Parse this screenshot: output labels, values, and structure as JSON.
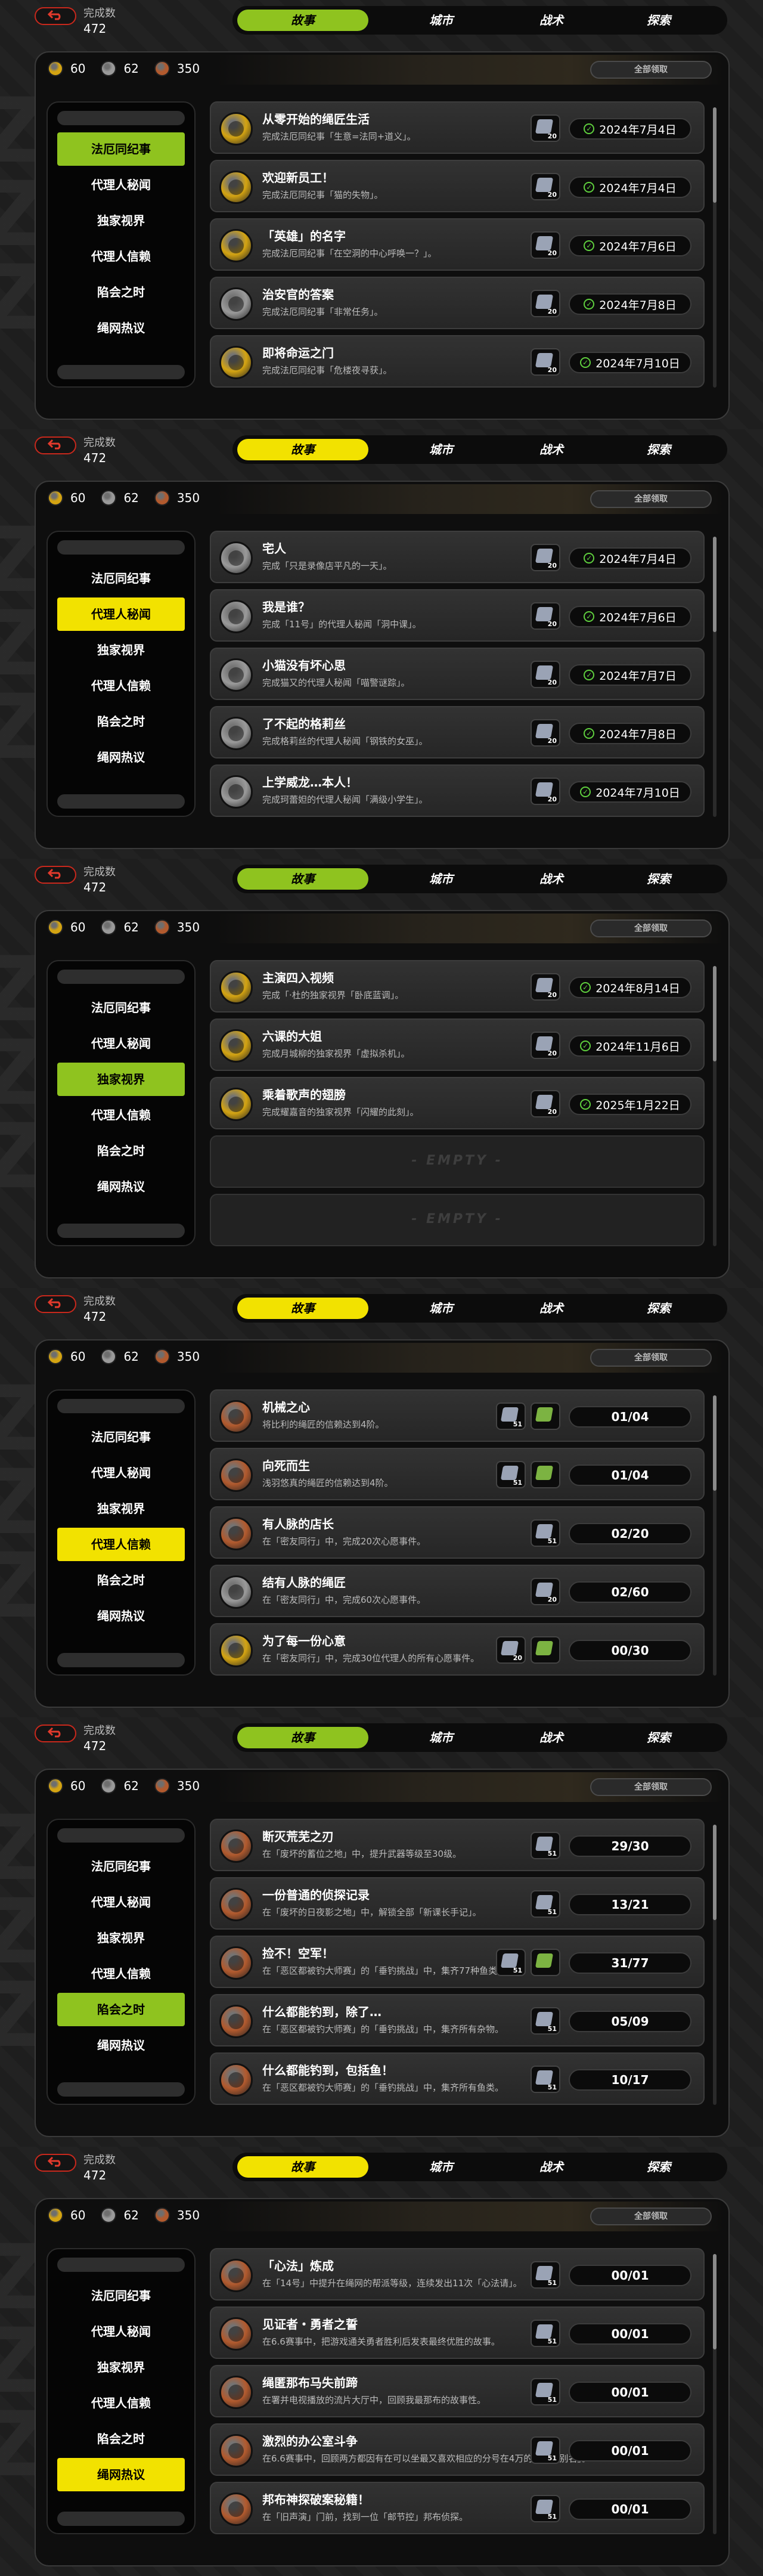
{
  "colors": {
    "green_accent": "#8fc31f",
    "yellow_accent": "#f2e200",
    "gold_badge": "#d4a412",
    "silver_badge": "#9a9a9a",
    "bronze_badge": "#b25a2e",
    "back_red": "#c8281c"
  },
  "common": {
    "count_label": "完成数",
    "count_value": "472",
    "tabs": [
      "故事",
      "城市",
      "战术",
      "探索"
    ],
    "currency": [
      {
        "icon": "gold-medal-icon",
        "value": "60"
      },
      {
        "icon": "silver-medal-icon",
        "value": "62"
      },
      {
        "icon": "bronze-medal-icon",
        "value": "350"
      }
    ],
    "claim_all": "全部领取",
    "sidebar": [
      "法厄同纪事",
      "代理人秘闻",
      "独家视界",
      "代理人信赖",
      "陷会之时",
      "绳网热议"
    ],
    "empty_label": "- EMPTY -"
  },
  "panels": [
    {
      "accent": "green",
      "active_sidebar": 0,
      "cards": [
        {
          "medal": "gold",
          "title": "从零开始的绳匠生活",
          "desc": "完成法厄同纪事「生意=法同+道义」。",
          "reward": "20",
          "reward_type": "blue",
          "kind": "date",
          "value": "2024年7月4日"
        },
        {
          "medal": "gold",
          "title": "欢迎新员工！",
          "desc": "完成法厄同纪事「猫的失物」。",
          "reward": "20",
          "reward_type": "blue",
          "kind": "date",
          "value": "2024年7月4日"
        },
        {
          "medal": "gold",
          "title": "「英雄」的名字",
          "desc": "完成法厄同纪事「在空洞的中心呼唤一？」。",
          "reward": "20",
          "reward_type": "blue",
          "kind": "date",
          "value": "2024年7月6日"
        },
        {
          "medal": "silver",
          "title": "治安官的答案",
          "desc": "完成法厄同纪事「非常任务」。",
          "reward": "20",
          "reward_type": "blue",
          "kind": "date",
          "value": "2024年7月8日"
        },
        {
          "medal": "gold",
          "title": "即将命运之门",
          "desc": "完成法厄同纪事「危楼夜寻获」。",
          "reward": "20",
          "reward_type": "blue",
          "kind": "date",
          "value": "2024年7月10日"
        }
      ]
    },
    {
      "accent": "yellow",
      "active_sidebar": 1,
      "cards": [
        {
          "medal": "silver",
          "title": "宅人",
          "desc": "完成「只是录像店平凡的一天」。",
          "reward": "20",
          "reward_type": "blue",
          "kind": "date",
          "value": "2024年7月4日"
        },
        {
          "medal": "silver",
          "title": "我是谁？",
          "desc": "完成「11号」的代理人秘闻「洞中课」。",
          "reward": "20",
          "reward_type": "blue",
          "kind": "date",
          "value": "2024年7月6日"
        },
        {
          "medal": "silver",
          "title": "小猫没有坏心思",
          "desc": "完成猫又的代理人秘闻「喵警谜踪」。",
          "reward": "20",
          "reward_type": "blue",
          "kind": "date",
          "value": "2024年7月7日"
        },
        {
          "medal": "silver",
          "title": "了不起的格莉丝",
          "desc": "完成格莉丝的代理人秘闻「钢铁的女巫」。",
          "reward": "20",
          "reward_type": "blue",
          "kind": "date",
          "value": "2024年7月8日"
        },
        {
          "medal": "silver",
          "title": "上学威龙…本人！",
          "desc": "完成珂蕾妲的代理人秘闻「满级小学生」。",
          "reward": "20",
          "reward_type": "blue",
          "kind": "date",
          "value": "2024年7月10日"
        }
      ]
    },
    {
      "accent": "green",
      "active_sidebar": 2,
      "cards": [
        {
          "medal": "gold",
          "title": "主演四入视频",
          "desc": "完成「·杜的独家视界「卧底蓝调」。",
          "reward": "20",
          "reward_type": "blue",
          "kind": "date",
          "value": "2024年8月14日"
        },
        {
          "medal": "gold",
          "title": "六课的大姐",
          "desc": "完成月城柳的独家视界「虚拟杀机」。",
          "reward": "20",
          "reward_type": "blue",
          "kind": "date",
          "value": "2024年11月6日"
        },
        {
          "medal": "gold",
          "title": "乘着歌声的翅膀",
          "desc": "完成耀嘉音的独家视界「闪耀的此刻」。",
          "reward": "20",
          "reward_type": "blue",
          "kind": "date",
          "value": "2025年1月22日"
        },
        {
          "empty": true
        },
        {
          "empty": true
        }
      ]
    },
    {
      "accent": "yellow",
      "active_sidebar": 3,
      "cards": [
        {
          "medal": "bronze",
          "title": "机械之心",
          "desc": "将比利的绳匠的信赖达到4阶。",
          "reward": "51",
          "reward_type": "blue",
          "extra": true,
          "kind": "progress",
          "value": "01/04"
        },
        {
          "medal": "bronze",
          "title": "向死而生",
          "desc": "浅羽悠真的绳匠的信赖达到4阶。",
          "reward": "51",
          "reward_type": "blue",
          "extra": true,
          "kind": "progress",
          "value": "01/04"
        },
        {
          "medal": "bronze",
          "title": "有人脉的店长",
          "desc": "在「密友同行」中，完成20次心愿事件。",
          "reward": "51",
          "reward_type": "blue",
          "kind": "progress",
          "value": "02/20"
        },
        {
          "medal": "silver",
          "title": "结有人脉的绳匠",
          "desc": "在「密友同行」中，完成60次心愿事件。",
          "reward": "20",
          "reward_type": "blue",
          "kind": "progress",
          "value": "02/60"
        },
        {
          "medal": "gold",
          "title": "为了每一份心意",
          "desc": "在「密友同行」中，完成30位代理人的所有心愿事件。",
          "reward": "20",
          "reward_type": "blue",
          "extra": true,
          "kind": "progress",
          "value": "00/30"
        }
      ]
    },
    {
      "accent": "green",
      "active_sidebar": 4,
      "cards": [
        {
          "medal": "bronze",
          "title": "断灭荒芜之刃",
          "desc": "在「废坏的蓄位之地」中，提升武器等级至30级。",
          "reward": "51",
          "reward_type": "blue",
          "kind": "progress",
          "value": "29/30"
        },
        {
          "medal": "bronze",
          "title": "一份普通的侦探记录",
          "desc": "在「废坏的日夜影之地」中，解锁全部「新课长手记」。",
          "reward": "51",
          "reward_type": "blue",
          "kind": "progress",
          "value": "13/21"
        },
        {
          "medal": "bronze",
          "title": "捡不！空军！",
          "desc": "在「恶区都被钓大师赛」的「垂钓挑战」中，集齐77种鱼类。",
          "reward": "51",
          "reward_type": "blue",
          "extra": true,
          "kind": "progress",
          "value": "31/77"
        },
        {
          "medal": "bronze",
          "title": "什么都能钓到，除了…",
          "desc": "在「恶区都被钓大师赛」的「垂钓挑战」中，集齐所有杂物。",
          "reward": "51",
          "reward_type": "blue",
          "kind": "progress",
          "value": "05/09"
        },
        {
          "medal": "bronze",
          "title": "什么都能钓到，包括鱼！",
          "desc": "在「恶区都被钓大师赛」的「垂钓挑战」中，集齐所有鱼类。",
          "reward": "51",
          "reward_type": "blue",
          "kind": "progress",
          "value": "10/17"
        }
      ]
    },
    {
      "accent": "yellow",
      "active_sidebar": 5,
      "cards": [
        {
          "medal": "bronze",
          "title": "「心法」炼成",
          "desc": "在「14号」中提升在绳网的帮派等级，连续发出11次「心法请」。",
          "reward": "51",
          "reward_type": "blue",
          "kind": "progress",
          "value": "00/01"
        },
        {
          "medal": "bronze",
          "title": "见证者・勇者之誓",
          "desc": "在6.6赛事中，把游戏通关勇者胜利后发表最终优胜的故事。",
          "reward": "51",
          "reward_type": "blue",
          "kind": "progress",
          "value": "00/01"
        },
        {
          "medal": "bronze",
          "title": "绳匿那布马失前蹄",
          "desc": "在署并电视播放的流片大厅中，回顾我最那布的故事性。",
          "reward": "51",
          "reward_type": "blue",
          "kind": "progress",
          "value": "00/01"
        },
        {
          "medal": "bronze",
          "title": "激烈的办公室斗争",
          "desc": "在6.6赛事中，回顾两方都因有在可以坐最又喜欢相应的分号在4万的向神「别名」。",
          "reward": "51",
          "reward_type": "blue",
          "kind": "progress",
          "value": "00/01"
        },
        {
          "medal": "bronze",
          "title": "邦布神探破案秘籍！",
          "desc": "在「旧声演」门前，找到一位「邮节控」邦布侦探。",
          "reward": "51",
          "reward_type": "blue",
          "kind": "progress",
          "value": "00/01"
        }
      ]
    }
  ]
}
